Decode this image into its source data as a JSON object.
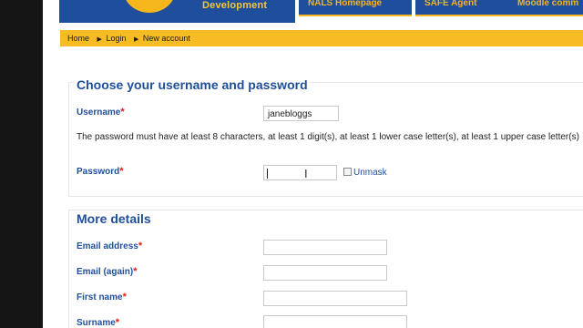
{
  "header": {
    "logo_sub": "Development",
    "tabs": [
      "NALS Homepage",
      "SAFE Agent",
      "Moodle comm"
    ]
  },
  "breadcrumb": [
    "Home",
    "Login",
    "New account"
  ],
  "section1": {
    "legend": "Choose your username and password",
    "username_label": "Username",
    "username_value": "janebloggs",
    "password_note": "The password must have at least 8 characters, at least 1 digit(s), at least 1 lower case letter(s), at least 1 upper case letter(s)",
    "password_label": "Password",
    "unmask_label": "Unmask"
  },
  "section2": {
    "legend": "More details",
    "fields": [
      "Email address",
      "Email (again)",
      "First name",
      "Surname"
    ]
  },
  "required_mark": "*"
}
